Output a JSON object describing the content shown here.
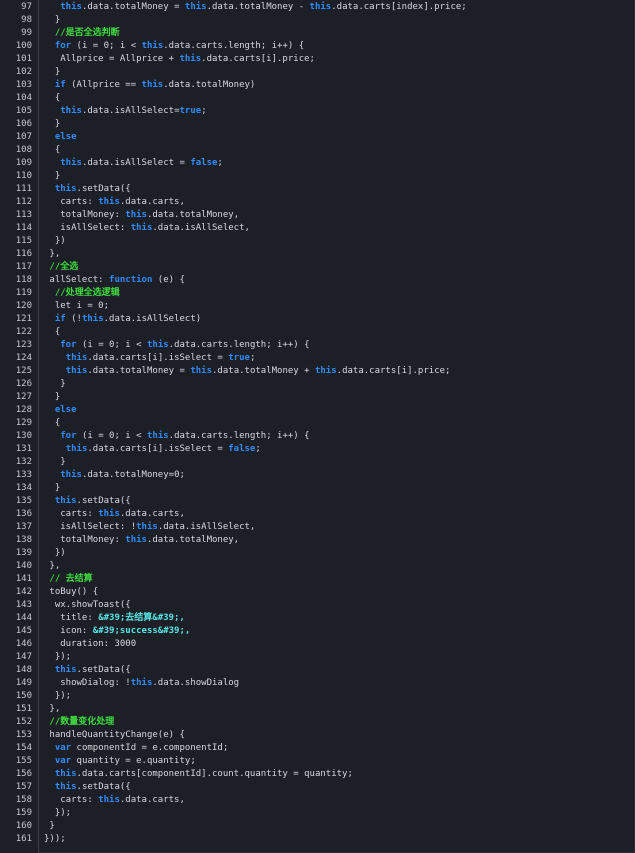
{
  "colors": {
    "background": "#1c1f26",
    "line_number": "#c6c9cf",
    "text": "#d7d9de",
    "keyword": "#2f8cff",
    "comment": "#3fdc3f",
    "string": "#59e6e6"
  },
  "lines": [
    {
      "n": "97",
      "tokens": [
        {
          "t": "   "
        },
        {
          "t": "this",
          "k": "kw"
        },
        {
          "t": ".data.totalMoney = "
        },
        {
          "t": "this",
          "k": "kw"
        },
        {
          "t": ".data.totalMoney - "
        },
        {
          "t": "this",
          "k": "kw"
        },
        {
          "t": ".data.carts[index].price;"
        }
      ]
    },
    {
      "n": "98",
      "tokens": [
        {
          "t": "  }"
        }
      ]
    },
    {
      "n": "99",
      "tokens": [
        {
          "t": "  "
        },
        {
          "t": "//是否全选判断",
          "k": "cm"
        }
      ]
    },
    {
      "n": "100",
      "tokens": [
        {
          "t": "  "
        },
        {
          "t": "for",
          "k": "kw"
        },
        {
          "t": " (i = 0; i < "
        },
        {
          "t": "this",
          "k": "kw"
        },
        {
          "t": ".data.carts.length; i++) {"
        }
      ]
    },
    {
      "n": "101",
      "tokens": [
        {
          "t": "   Allprice = Allprice + "
        },
        {
          "t": "this",
          "k": "kw"
        },
        {
          "t": ".data.carts[i].price;"
        }
      ]
    },
    {
      "n": "102",
      "tokens": [
        {
          "t": "  }"
        }
      ]
    },
    {
      "n": "103",
      "tokens": [
        {
          "t": "  "
        },
        {
          "t": "if",
          "k": "kw"
        },
        {
          "t": " (Allprice == "
        },
        {
          "t": "this",
          "k": "kw"
        },
        {
          "t": ".data.totalMoney)"
        }
      ]
    },
    {
      "n": "104",
      "tokens": [
        {
          "t": "  {"
        }
      ]
    },
    {
      "n": "105",
      "tokens": [
        {
          "t": "   "
        },
        {
          "t": "this",
          "k": "kw"
        },
        {
          "t": ".data.isAllSelect="
        },
        {
          "t": "true",
          "k": "kw"
        },
        {
          "t": ";"
        }
      ]
    },
    {
      "n": "106",
      "tokens": [
        {
          "t": "  }"
        }
      ]
    },
    {
      "n": "107",
      "tokens": [
        {
          "t": "  "
        },
        {
          "t": "else",
          "k": "kw"
        }
      ]
    },
    {
      "n": "108",
      "tokens": [
        {
          "t": "  {"
        }
      ]
    },
    {
      "n": "109",
      "tokens": [
        {
          "t": "   "
        },
        {
          "t": "this",
          "k": "kw"
        },
        {
          "t": ".data.isAllSelect = "
        },
        {
          "t": "false",
          "k": "kw"
        },
        {
          "t": ";"
        }
      ]
    },
    {
      "n": "110",
      "tokens": [
        {
          "t": "  }"
        }
      ]
    },
    {
      "n": "111",
      "tokens": [
        {
          "t": "  "
        },
        {
          "t": "this",
          "k": "kw"
        },
        {
          "t": ".setData({"
        }
      ]
    },
    {
      "n": "112",
      "tokens": [
        {
          "t": "   carts: "
        },
        {
          "t": "this",
          "k": "kw"
        },
        {
          "t": ".data.carts,"
        }
      ]
    },
    {
      "n": "113",
      "tokens": [
        {
          "t": "   totalMoney: "
        },
        {
          "t": "this",
          "k": "kw"
        },
        {
          "t": ".data.totalMoney,"
        }
      ]
    },
    {
      "n": "114",
      "tokens": [
        {
          "t": "   isAllSelect: "
        },
        {
          "t": "this",
          "k": "kw"
        },
        {
          "t": ".data.isAllSelect,"
        }
      ]
    },
    {
      "n": "115",
      "tokens": [
        {
          "t": "  })"
        }
      ]
    },
    {
      "n": "116",
      "tokens": [
        {
          "t": " },"
        }
      ]
    },
    {
      "n": "117",
      "tokens": [
        {
          "t": " "
        },
        {
          "t": "//全选",
          "k": "cm"
        }
      ]
    },
    {
      "n": "118",
      "tokens": [
        {
          "t": " allSelect: "
        },
        {
          "t": "function",
          "k": "kw"
        },
        {
          "t": " (e) {"
        }
      ]
    },
    {
      "n": "119",
      "tokens": [
        {
          "t": "  "
        },
        {
          "t": "//处理全选逻辑",
          "k": "cm"
        }
      ]
    },
    {
      "n": "120",
      "tokens": [
        {
          "t": "  let i = 0;"
        }
      ]
    },
    {
      "n": "121",
      "tokens": [
        {
          "t": "  "
        },
        {
          "t": "if",
          "k": "kw"
        },
        {
          "t": " (!"
        },
        {
          "t": "this",
          "k": "kw"
        },
        {
          "t": ".data.isAllSelect)"
        }
      ]
    },
    {
      "n": "122",
      "tokens": [
        {
          "t": "  {"
        }
      ]
    },
    {
      "n": "123",
      "tokens": [
        {
          "t": "   "
        },
        {
          "t": "for",
          "k": "kw"
        },
        {
          "t": " (i = 0; i < "
        },
        {
          "t": "this",
          "k": "kw"
        },
        {
          "t": ".data.carts.length; i++) {"
        }
      ]
    },
    {
      "n": "124",
      "tokens": [
        {
          "t": "    "
        },
        {
          "t": "this",
          "k": "kw"
        },
        {
          "t": ".data.carts[i].isSelect = "
        },
        {
          "t": "true",
          "k": "kw"
        },
        {
          "t": ";"
        }
      ]
    },
    {
      "n": "125",
      "tokens": [
        {
          "t": "    "
        },
        {
          "t": "this",
          "k": "kw"
        },
        {
          "t": ".data.totalMoney = "
        },
        {
          "t": "this",
          "k": "kw"
        },
        {
          "t": ".data.totalMoney + "
        },
        {
          "t": "this",
          "k": "kw"
        },
        {
          "t": ".data.carts[i].price;"
        }
      ]
    },
    {
      "n": "126",
      "tokens": [
        {
          "t": "   }"
        }
      ]
    },
    {
      "n": "127",
      "tokens": [
        {
          "t": "  }"
        }
      ]
    },
    {
      "n": "128",
      "tokens": [
        {
          "t": "  "
        },
        {
          "t": "else",
          "k": "kw"
        }
      ]
    },
    {
      "n": "129",
      "tokens": [
        {
          "t": "  {"
        }
      ]
    },
    {
      "n": "130",
      "tokens": [
        {
          "t": "   "
        },
        {
          "t": "for",
          "k": "kw"
        },
        {
          "t": " (i = 0; i < "
        },
        {
          "t": "this",
          "k": "kw"
        },
        {
          "t": ".data.carts.length; i++) {"
        }
      ]
    },
    {
      "n": "131",
      "tokens": [
        {
          "t": "    "
        },
        {
          "t": "this",
          "k": "kw"
        },
        {
          "t": ".data.carts[i].isSelect = "
        },
        {
          "t": "false",
          "k": "kw"
        },
        {
          "t": ";"
        }
      ]
    },
    {
      "n": "132",
      "tokens": [
        {
          "t": "   }"
        }
      ]
    },
    {
      "n": "133",
      "tokens": [
        {
          "t": "   "
        },
        {
          "t": "this",
          "k": "kw"
        },
        {
          "t": ".data.totalMoney=0;"
        }
      ]
    },
    {
      "n": "134",
      "tokens": [
        {
          "t": "  }"
        }
      ]
    },
    {
      "n": "135",
      "tokens": [
        {
          "t": "  "
        },
        {
          "t": "this",
          "k": "kw"
        },
        {
          "t": ".setData({"
        }
      ]
    },
    {
      "n": "136",
      "tokens": [
        {
          "t": "   carts: "
        },
        {
          "t": "this",
          "k": "kw"
        },
        {
          "t": ".data.carts,"
        }
      ]
    },
    {
      "n": "137",
      "tokens": [
        {
          "t": "   isAllSelect: !"
        },
        {
          "t": "this",
          "k": "kw"
        },
        {
          "t": ".data.isAllSelect,"
        }
      ]
    },
    {
      "n": "138",
      "tokens": [
        {
          "t": "   totalMoney: "
        },
        {
          "t": "this",
          "k": "kw"
        },
        {
          "t": ".data.totalMoney,"
        }
      ]
    },
    {
      "n": "139",
      "tokens": [
        {
          "t": "  })"
        }
      ]
    },
    {
      "n": "140",
      "tokens": [
        {
          "t": " },"
        }
      ]
    },
    {
      "n": "141",
      "tokens": [
        {
          "t": " "
        },
        {
          "t": "// 去结算",
          "k": "cm"
        }
      ]
    },
    {
      "n": "142",
      "tokens": [
        {
          "t": " toBuy() {"
        }
      ]
    },
    {
      "n": "143",
      "tokens": [
        {
          "t": "  wx.showToast({"
        }
      ]
    },
    {
      "n": "144",
      "tokens": [
        {
          "t": "   title: "
        },
        {
          "t": "&#39;去结算&#39;,",
          "k": "st"
        }
      ]
    },
    {
      "n": "145",
      "tokens": [
        {
          "t": "   icon: "
        },
        {
          "t": "&#39;success&#39;,",
          "k": "st"
        }
      ]
    },
    {
      "n": "146",
      "tokens": [
        {
          "t": "   duration: 3000"
        }
      ]
    },
    {
      "n": "147",
      "tokens": [
        {
          "t": "  });"
        }
      ]
    },
    {
      "n": "148",
      "tokens": [
        {
          "t": "  "
        },
        {
          "t": "this",
          "k": "kw"
        },
        {
          "t": ".setData({"
        }
      ]
    },
    {
      "n": "149",
      "tokens": [
        {
          "t": "   showDialog: !"
        },
        {
          "t": "this",
          "k": "kw"
        },
        {
          "t": ".data.showDialog"
        }
      ]
    },
    {
      "n": "150",
      "tokens": [
        {
          "t": "  });"
        }
      ]
    },
    {
      "n": "151",
      "tokens": [
        {
          "t": " },"
        }
      ]
    },
    {
      "n": "152",
      "tokens": [
        {
          "t": " "
        },
        {
          "t": "//数量变化处理",
          "k": "cm"
        }
      ]
    },
    {
      "n": "153",
      "tokens": [
        {
          "t": " handleQuantityChange(e) {"
        }
      ]
    },
    {
      "n": "154",
      "tokens": [
        {
          "t": "  "
        },
        {
          "t": "var",
          "k": "kw"
        },
        {
          "t": " componentId = e.componentId;"
        }
      ]
    },
    {
      "n": "155",
      "tokens": [
        {
          "t": "  "
        },
        {
          "t": "var",
          "k": "kw"
        },
        {
          "t": " quantity = e.quantity;"
        }
      ]
    },
    {
      "n": "156",
      "tokens": [
        {
          "t": "  "
        },
        {
          "t": "this",
          "k": "kw"
        },
        {
          "t": ".data.carts[componentId].count.quantity = quantity;"
        }
      ]
    },
    {
      "n": "157",
      "tokens": [
        {
          "t": "  "
        },
        {
          "t": "this",
          "k": "kw"
        },
        {
          "t": ".setData({"
        }
      ]
    },
    {
      "n": "158",
      "tokens": [
        {
          "t": "   carts: "
        },
        {
          "t": "this",
          "k": "kw"
        },
        {
          "t": ".data.carts,"
        }
      ]
    },
    {
      "n": "159",
      "tokens": [
        {
          "t": "  });"
        }
      ]
    },
    {
      "n": "160",
      "tokens": [
        {
          "t": " }"
        }
      ]
    },
    {
      "n": "161",
      "tokens": [
        {
          "t": "}));"
        }
      ]
    }
  ]
}
